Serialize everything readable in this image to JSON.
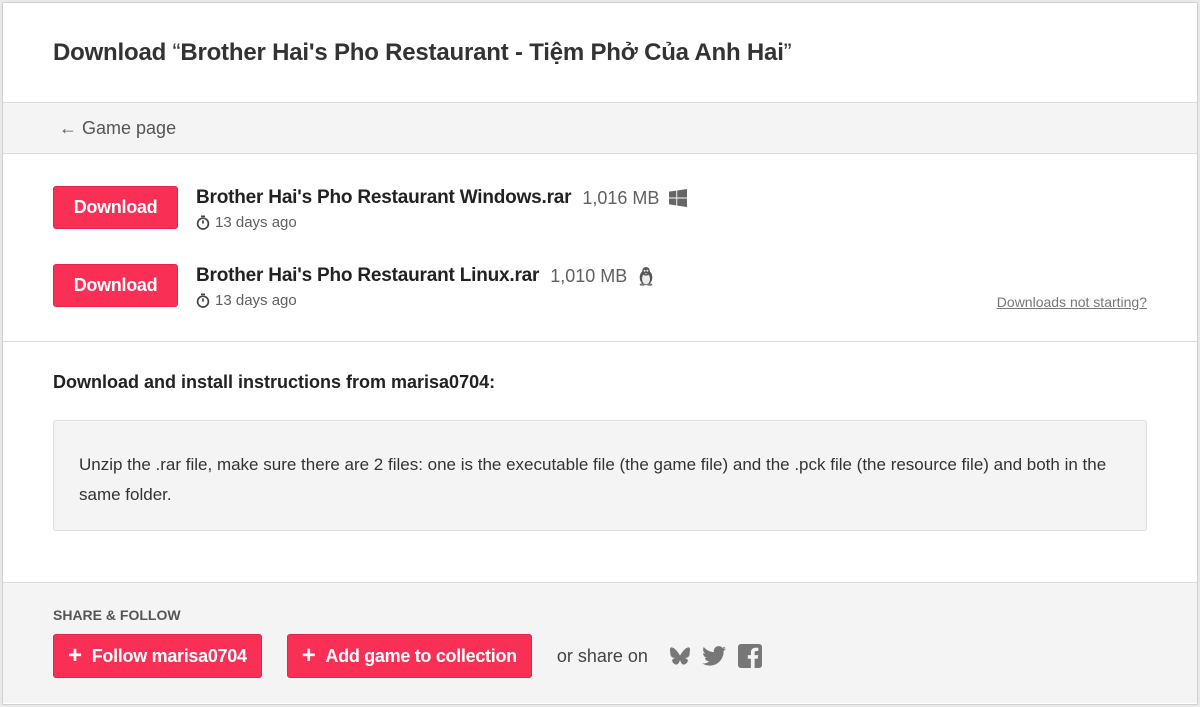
{
  "header": {
    "prefix": "Download",
    "open_quote": "“",
    "game_title": "Brother Hai's Pho Restaurant - Tiệm Phở Của Anh Hai",
    "close_quote": "”"
  },
  "nav": {
    "back_arrow": "←",
    "back_label": "Game page"
  },
  "uploads": [
    {
      "button_label": "Download",
      "filename": "Brother Hai's Pho Restaurant Windows.rar",
      "size": "1,016 MB",
      "platform_icon": "windows-icon",
      "date": "13 days ago"
    },
    {
      "button_label": "Download",
      "filename": "Brother Hai's Pho Restaurant Linux.rar",
      "size": "1,010 MB",
      "platform_icon": "linux-icon",
      "date": "13 days ago"
    }
  ],
  "downloads_not_starting": "Downloads not starting?",
  "instructions": {
    "heading": "Download and install instructions from marisa0704:",
    "body": "Unzip the .rar file, make sure there are 2 files: one is the executable file (the game file) and the .pck file (the resource file) and both in the same folder."
  },
  "share": {
    "heading": "SHARE & FOLLOW",
    "follow_label": "Follow marisa0704",
    "collection_label": "Add game to collection",
    "plus_symbol": "+",
    "or_share_on": "or share on",
    "social_icons": [
      "bluesky-icon",
      "twitter-icon",
      "facebook-icon"
    ]
  },
  "colors": {
    "accent": "#fa2f55",
    "panel_bg": "#f4f4f4",
    "icon_gray": "#777777"
  }
}
